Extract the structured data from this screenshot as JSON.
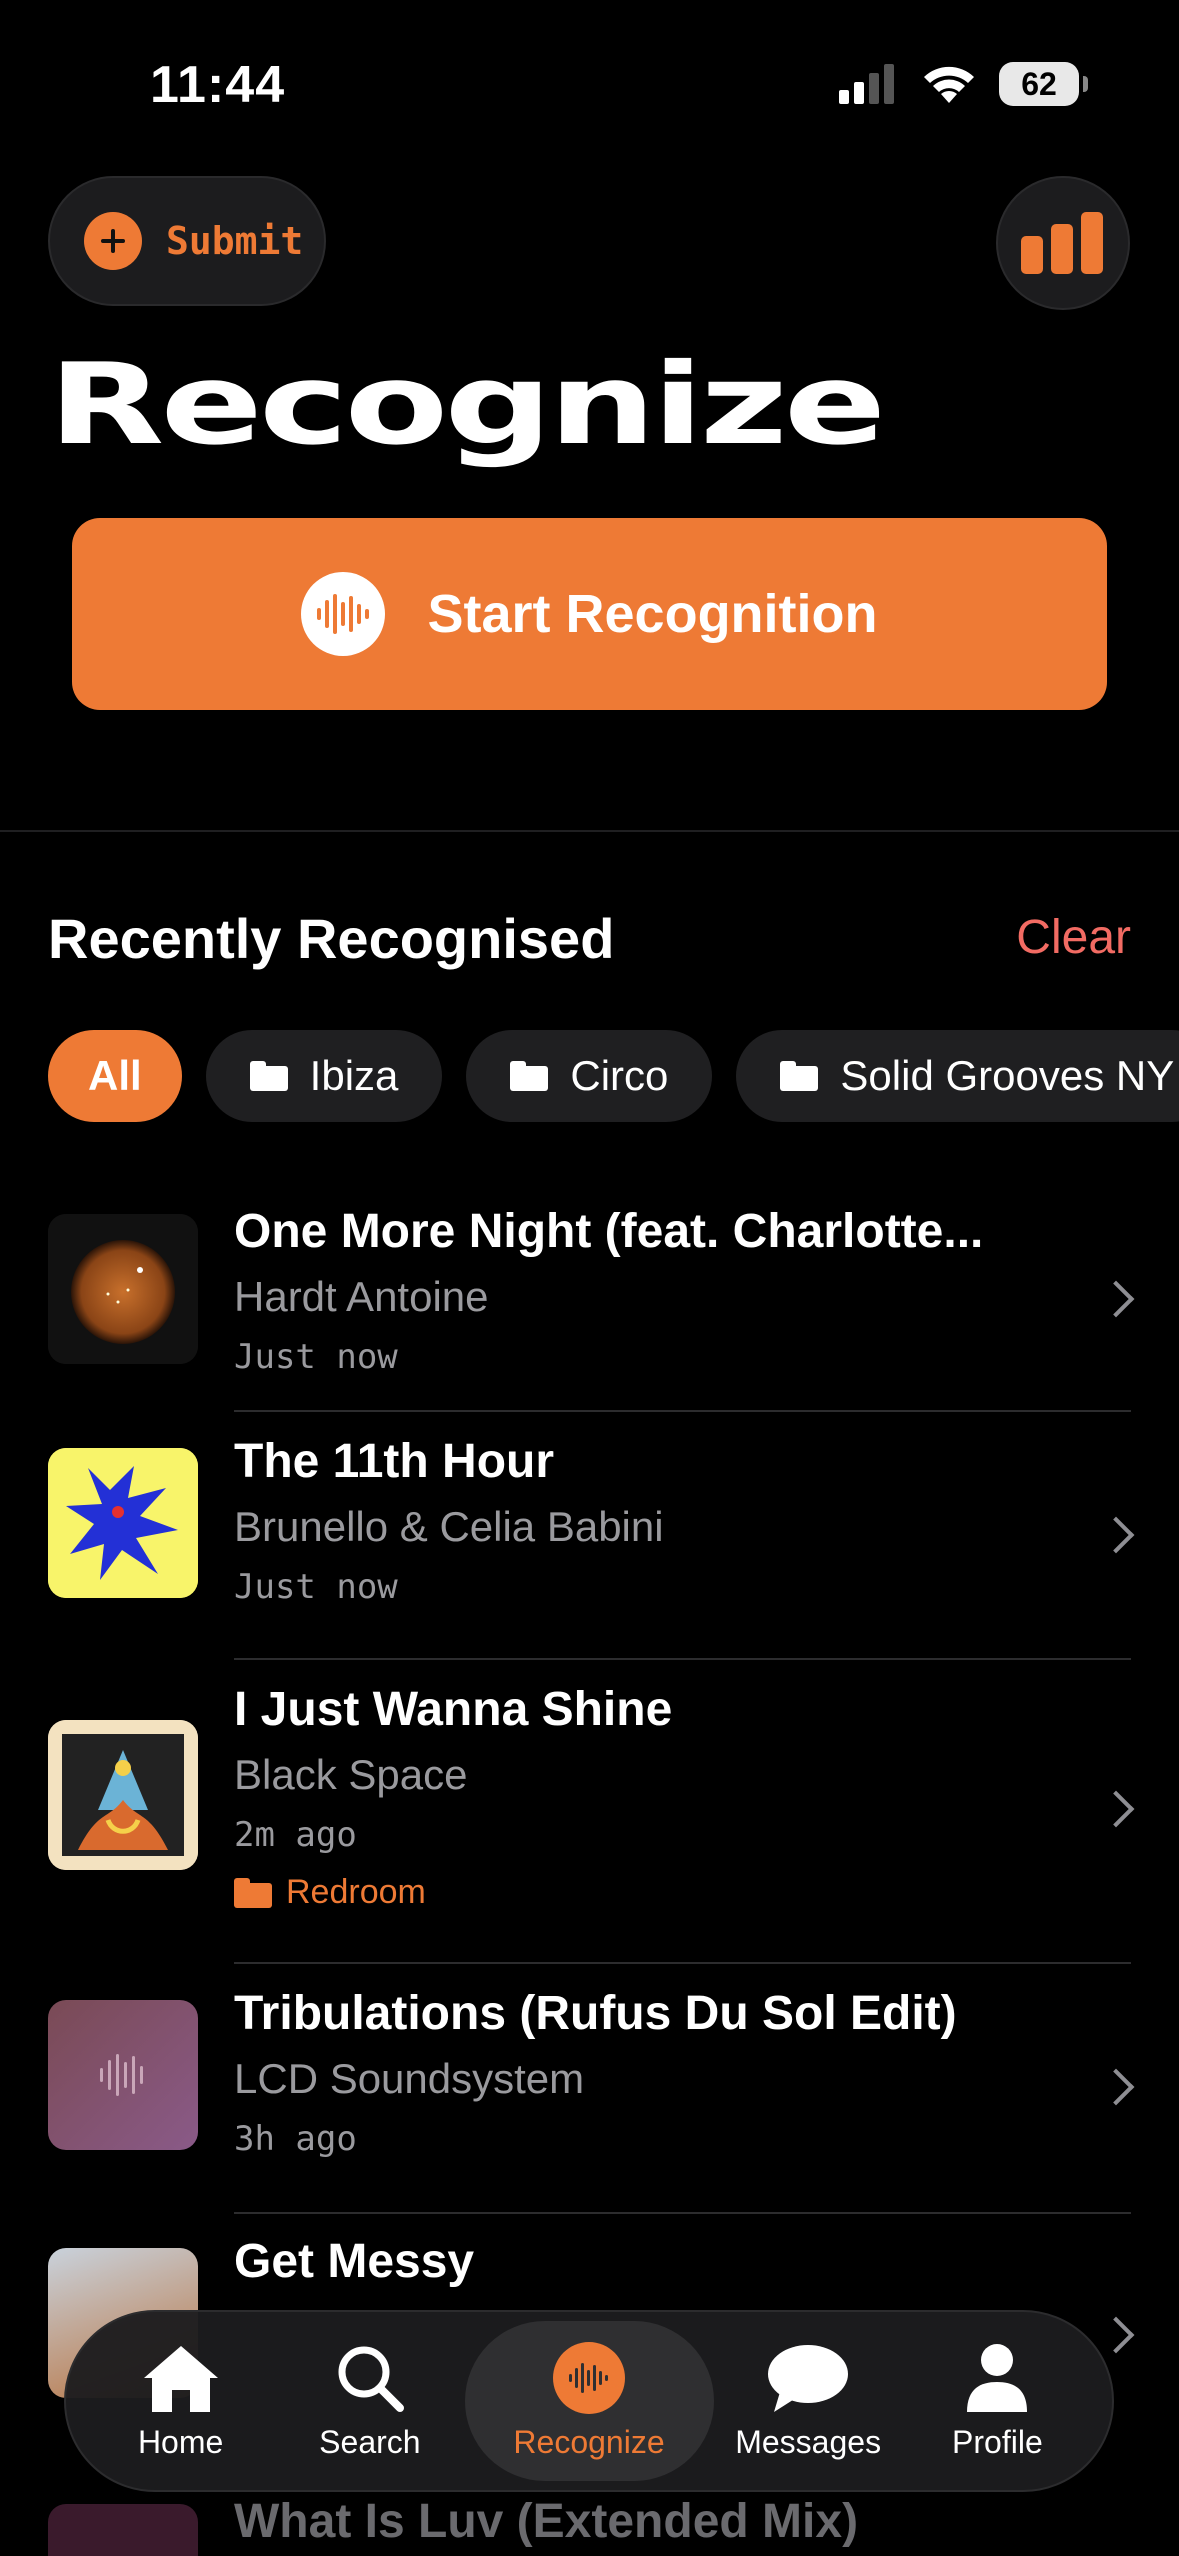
{
  "status_bar": {
    "time": "11:44",
    "battery": "62"
  },
  "header": {
    "submit_label": "Submit",
    "title": "Recognize"
  },
  "primary_action": {
    "label": "Start Recognition"
  },
  "recent": {
    "title": "Recently Recognised",
    "clear_label": "Clear",
    "filters": [
      "All",
      "Ibiza",
      "Circo",
      "Solid Grooves NY"
    ],
    "tracks": [
      {
        "title": "One More Night (feat. Charlotte...",
        "artist": "Hardt Antoine",
        "time": "Just now",
        "folder": ""
      },
      {
        "title": "The 11th Hour",
        "artist": "Brunello & Celia Babini",
        "time": "Just now",
        "folder": ""
      },
      {
        "title": "I Just Wanna Shine",
        "artist": "Black Space",
        "time": "2m ago",
        "folder": "Redroom"
      },
      {
        "title": "Tribulations (Rufus Du Sol Edit)",
        "artist": "LCD Soundsystem",
        "time": "3h ago",
        "folder": ""
      },
      {
        "title": "Get Messy",
        "artist": "",
        "time": "",
        "folder": ""
      },
      {
        "title": "What Is Luv (Extended Mix)",
        "artist": "",
        "time": "",
        "folder": ""
      }
    ]
  },
  "tabbar": {
    "tabs": [
      {
        "label": "Home",
        "icon": "home-icon"
      },
      {
        "label": "Search",
        "icon": "search-icon"
      },
      {
        "label": "Recognize",
        "icon": "waveform-icon"
      },
      {
        "label": "Messages",
        "icon": "chat-bubble-icon"
      },
      {
        "label": "Profile",
        "icon": "person-icon"
      }
    ],
    "active": "Recognize"
  },
  "colors": {
    "accent": "#ee7a35",
    "clear": "#f26b63",
    "background": "#000000"
  }
}
